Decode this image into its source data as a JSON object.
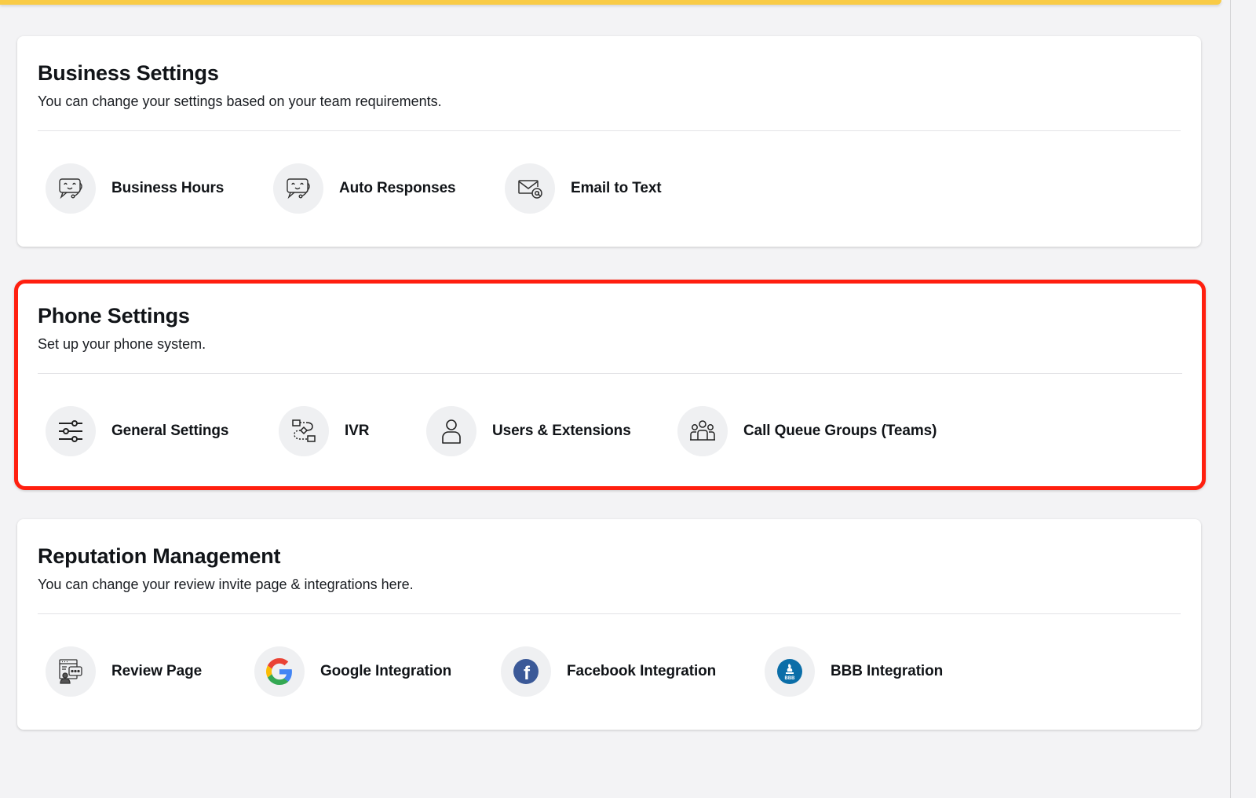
{
  "colors": {
    "top_bar": "#f9cb46",
    "highlight_border": "#ff1f0f",
    "facebook_blue": "#3b5998",
    "bbb_blue": "#0b6ea8"
  },
  "sections": [
    {
      "title": "Business Settings",
      "subtitle": "You can change your settings based on your team requirements.",
      "items": [
        {
          "label": "Business Hours",
          "icon": "chat-bot-icon"
        },
        {
          "label": "Auto Responses",
          "icon": "chat-bot-icon"
        },
        {
          "label": "Email to Text",
          "icon": "email-at-icon"
        }
      ]
    },
    {
      "title": "Phone Settings",
      "subtitle": "Set up your phone system.",
      "highlighted": true,
      "items": [
        {
          "label": "General Settings",
          "icon": "sliders-icon"
        },
        {
          "label": "IVR",
          "icon": "flowchart-icon"
        },
        {
          "label": "Users & Extensions",
          "icon": "user-icon"
        },
        {
          "label": "Call Queue Groups (Teams)",
          "icon": "team-icon"
        }
      ]
    },
    {
      "title": "Reputation Management",
      "subtitle": "You can change your review invite page & integrations here.",
      "items": [
        {
          "label": "Review Page",
          "icon": "review-page-icon"
        },
        {
          "label": "Google Integration",
          "icon": "google-icon"
        },
        {
          "label": "Facebook Integration",
          "icon": "facebook-icon"
        },
        {
          "label": "BBB Integration",
          "icon": "bbb-icon"
        }
      ]
    }
  ],
  "icon_text": {
    "facebook": "f",
    "bbb": "BBB"
  }
}
